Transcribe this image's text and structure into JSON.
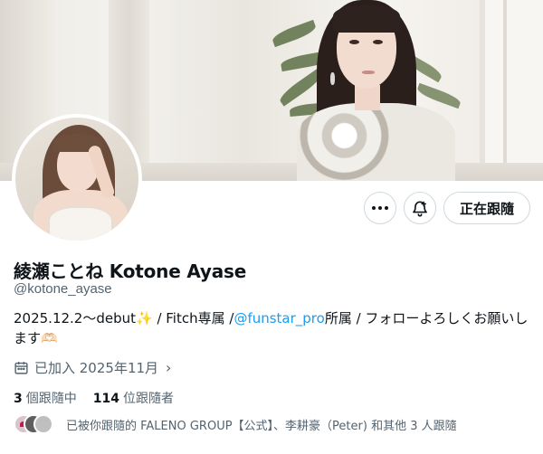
{
  "profile": {
    "display_name": "綾瀬ことね Kotone Ayase",
    "handle": "@kotone_ayase",
    "bio": {
      "part1": "2025.12.2～debut✨ / Fitch専属 /",
      "mention": "@funstar_pro",
      "part2": "所属 / フォローよろしくお願いします🫶🏻"
    },
    "joined": "已加入 2025年11月",
    "following_count": "3",
    "following_label": "個跟隨中",
    "followers_count": "114",
    "followers_label": "位跟隨者",
    "followed_by_text": "已被你跟隨的 FALENO GROUP【公式】、李耕豪（Peter) 和其他 3 人跟隨"
  },
  "actions": {
    "more_icon": "more-icon",
    "notify_icon": "bell-plus-icon",
    "follow_label": "正在跟隨"
  },
  "icons": {
    "calendar": "calendar-icon",
    "chevron": "chevron-right-icon",
    "chevron_glyph": "›"
  },
  "colors": {
    "accent": "#1d9bf0",
    "text": "#0f1419",
    "muted": "#536471",
    "border": "#cfd9de"
  }
}
